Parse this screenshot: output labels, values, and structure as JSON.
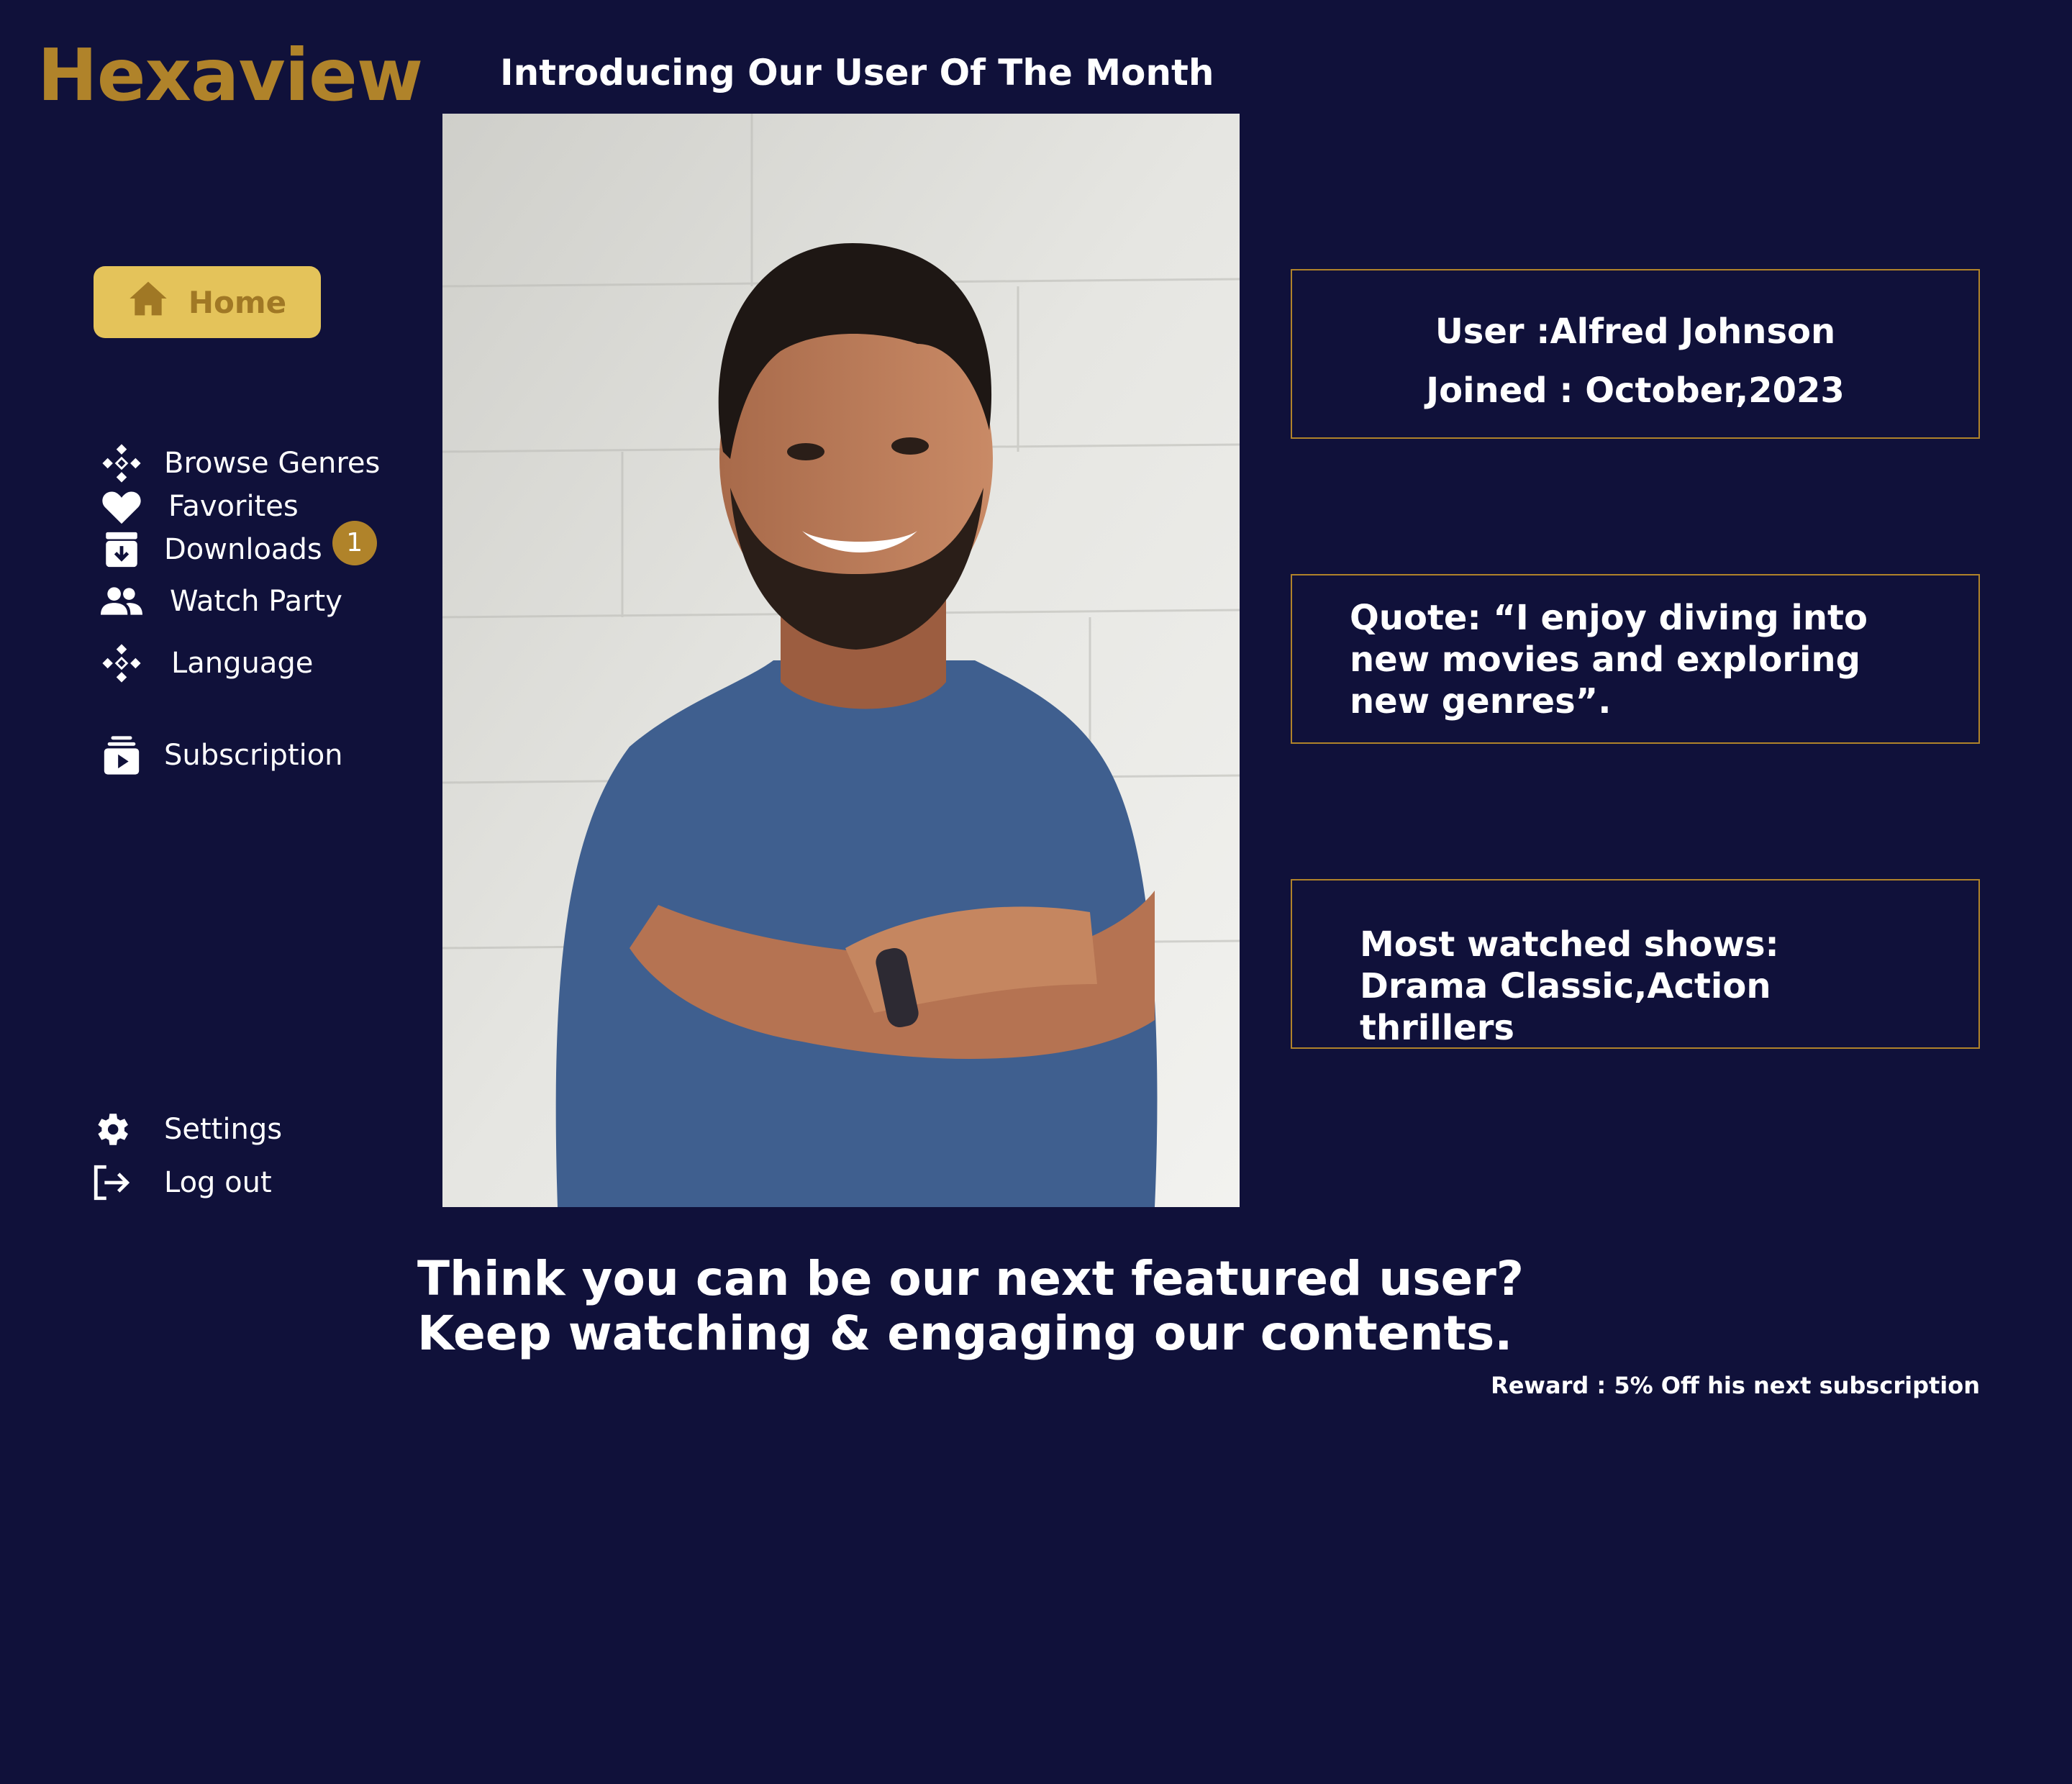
{
  "app": {
    "logo_text": "Hexaview",
    "accent_color": "#b0832a",
    "background_color": "#10113a",
    "home_button_color": "#e4c35a"
  },
  "header": {
    "title": "Introducing Our User Of The Month"
  },
  "sidebar": {
    "home": {
      "label": "Home",
      "icon": "home-icon"
    },
    "items": [
      {
        "label": "Browse Genres",
        "icon": "diamond-grid-icon"
      },
      {
        "label": "Favorites",
        "icon": "heart-icon"
      },
      {
        "label": "Downloads",
        "icon": "download-box-icon",
        "badge": "1"
      },
      {
        "label": "Watch Party",
        "icon": "people-icon"
      },
      {
        "label": "Language",
        "icon": "diamond-grid-icon"
      },
      {
        "label": "Subscription",
        "icon": "subscription-icon"
      }
    ],
    "bottom_items": [
      {
        "label": "Settings",
        "icon": "gear-icon"
      },
      {
        "label": "Log  out",
        "icon": "logout-icon"
      }
    ]
  },
  "featured": {
    "user_line": "User :Alfred Johnson",
    "joined_line": "Joined : October,2023",
    "quote": "Quote: “I enjoy diving into new movies and  exploring new genres”.",
    "shows": "Most watched shows: Drama Classic,Action thrillers"
  },
  "cta": {
    "line1": "Think you can  be our next featured user?",
    "line2": "Keep watching & engaging our contents."
  },
  "reward": "Reward : 5% Off his next subscription"
}
